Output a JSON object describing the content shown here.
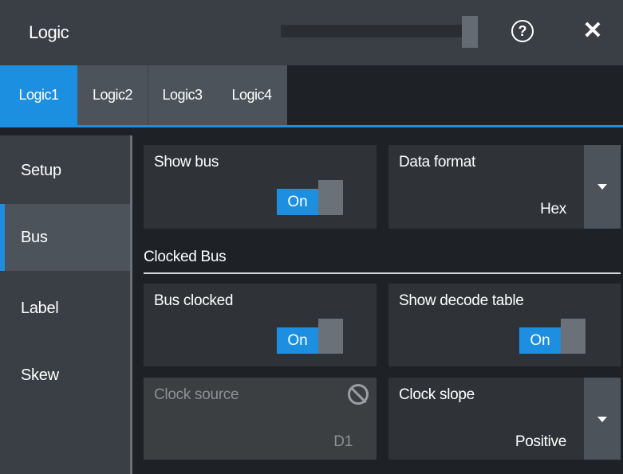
{
  "window": {
    "title": "Logic",
    "help_glyph": "?",
    "close_glyph": "✕"
  },
  "tabs": [
    {
      "label": "Logic1",
      "active": true
    },
    {
      "label": "Logic2",
      "active": false
    },
    {
      "label": "Logic3",
      "active": false
    },
    {
      "label": "Logic4",
      "active": false
    }
  ],
  "sidebar": {
    "items": [
      {
        "label": "Setup",
        "active": false
      },
      {
        "label": "Bus",
        "active": true
      },
      {
        "label": "Label",
        "active": false
      },
      {
        "label": "Skew",
        "active": false
      }
    ]
  },
  "bus": {
    "show_bus": {
      "label": "Show bus",
      "state": "On"
    },
    "data_format": {
      "label": "Data format",
      "value": "Hex"
    },
    "section_title": "Clocked Bus",
    "bus_clocked": {
      "label": "Bus clocked",
      "state": "On"
    },
    "show_decode_table": {
      "label": "Show decode table",
      "state": "On"
    },
    "clock_source": {
      "label": "Clock source",
      "value": "D1",
      "enabled": false
    },
    "clock_slope": {
      "label": "Clock slope",
      "value": "Positive"
    }
  },
  "colors": {
    "accent": "#1c8fe0",
    "title_bar": "#3a3f45",
    "panel": "#2f3338",
    "background": "#1e2227"
  },
  "icons": [
    "help-icon",
    "close-icon",
    "dropdown-arrow-icon",
    "disabled-icon"
  ]
}
